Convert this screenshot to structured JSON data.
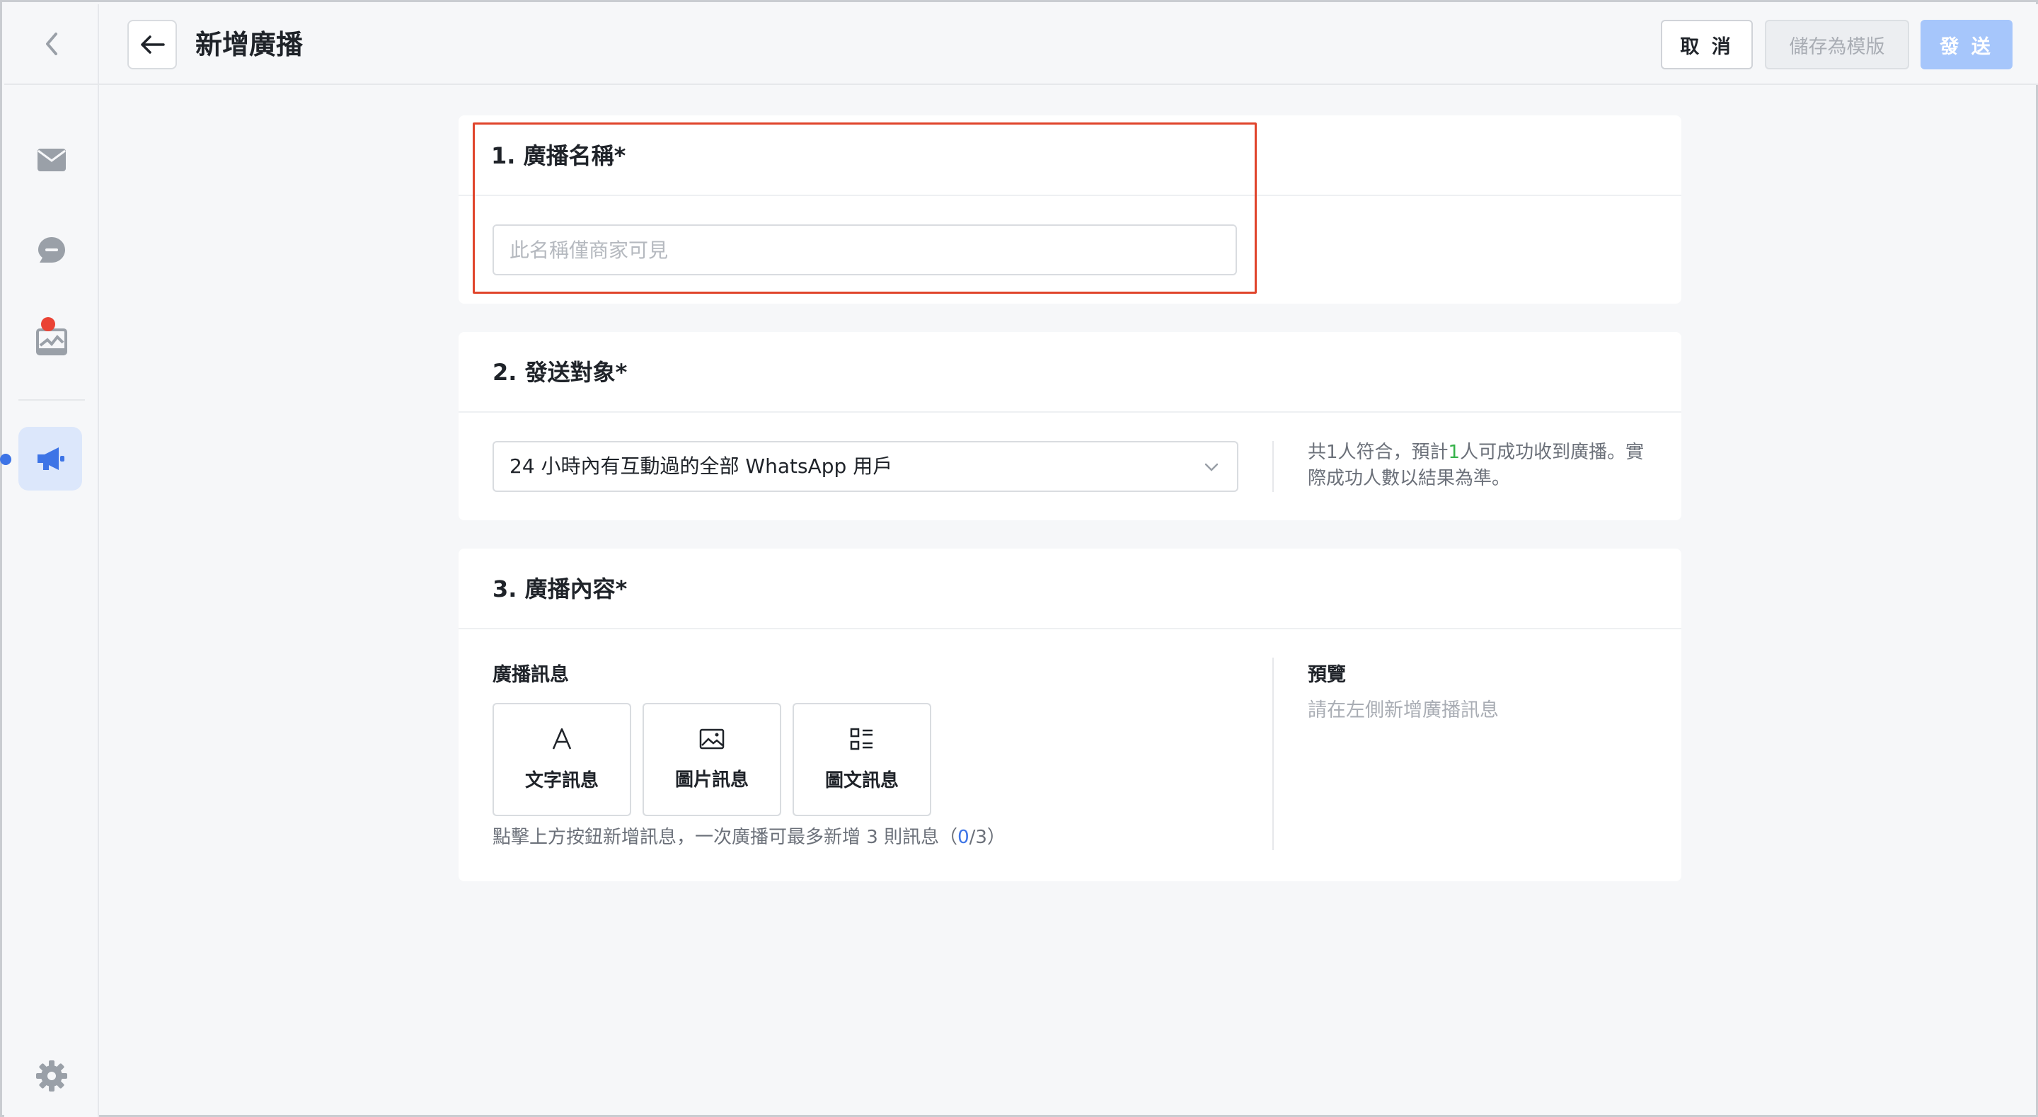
{
  "header": {
    "title": "新增廣播",
    "cancel_label": "取 消",
    "save_template_label": "儲存為模版",
    "send_label": "發 送"
  },
  "sidebar": {
    "items": [
      {
        "name": "inbox",
        "icon": "mail-icon"
      },
      {
        "name": "chat",
        "icon": "chat-bubble-icon"
      },
      {
        "name": "reports",
        "icon": "inbox-tray-icon",
        "has_notification": true
      },
      {
        "name": "broadcast",
        "icon": "megaphone-icon",
        "active": true
      },
      {
        "name": "settings",
        "icon": "gear-icon"
      }
    ]
  },
  "section1": {
    "title": "1. 廣播名稱*",
    "name_placeholder": "此名稱僅商家可見",
    "name_value": ""
  },
  "section2": {
    "title": "2. 發送對象*",
    "audience_selected": "24 小時內有互動過的全部 WhatsApp 用戶",
    "note_prefix": "共1人符合，預計",
    "note_count": "1",
    "note_suffix_line1": "人可成功收到廣播。實",
    "note_line2": "際成功人數以結果為準。"
  },
  "section3": {
    "title": "3. 廣播內容*",
    "messages_heading": "廣播訊息",
    "buttons": [
      {
        "label": "文字訊息",
        "icon": "text-a-icon"
      },
      {
        "label": "圖片訊息",
        "icon": "image-icon"
      },
      {
        "label": "圖文訊息",
        "icon": "list-layout-icon"
      }
    ],
    "hint_prefix": "點擊上方按鈕新增訊息，一次廣播可最多新增 3 則訊息（",
    "hint_current": "0",
    "hint_suffix": "/3）",
    "preview_heading": "預覽",
    "preview_empty": "請在左側新增廣播訊息"
  },
  "colors": {
    "accent": "#3d74e6",
    "send_disabled": "#a6c6fb",
    "highlight": "#e0442b",
    "success": "#36b24a"
  }
}
